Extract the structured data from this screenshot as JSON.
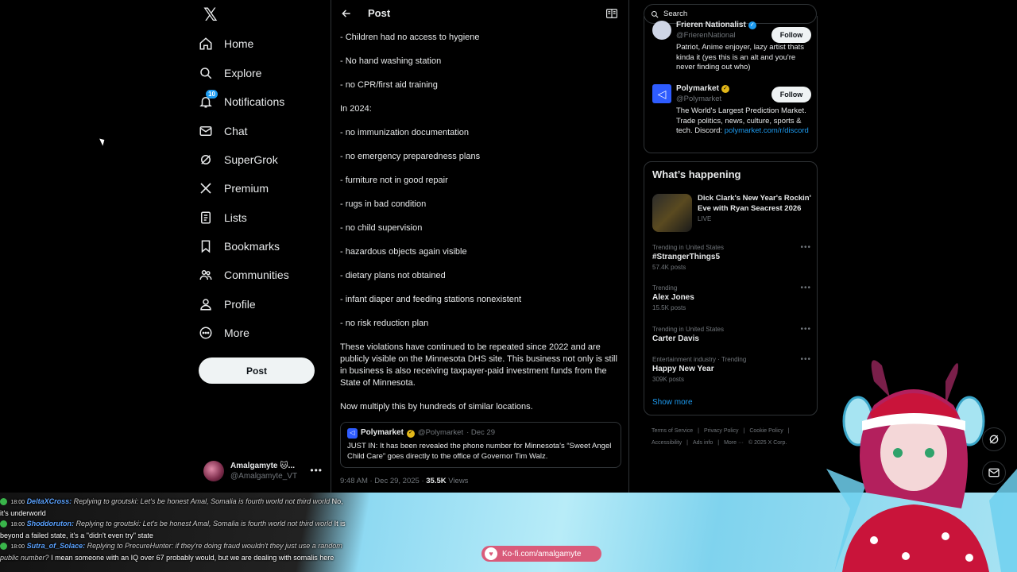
{
  "nav": {
    "logo": "X",
    "items": [
      {
        "label": "Home",
        "icon": "home-icon"
      },
      {
        "label": "Explore",
        "icon": "search-icon"
      },
      {
        "label": "Notifications",
        "icon": "bell-icon",
        "badge": "10"
      },
      {
        "label": "Chat",
        "icon": "mail-icon"
      },
      {
        "label": "SuperGrok",
        "icon": "grok-icon"
      },
      {
        "label": "Premium",
        "icon": "x-icon"
      },
      {
        "label": "Lists",
        "icon": "list-icon"
      },
      {
        "label": "Bookmarks",
        "icon": "bookmark-icon"
      },
      {
        "label": "Communities",
        "icon": "people-icon"
      },
      {
        "label": "Profile",
        "icon": "person-icon"
      },
      {
        "label": "More",
        "icon": "more-circle-icon"
      }
    ],
    "post_button": "Post",
    "account": {
      "name": "Amalgamyte 🐱...",
      "handle": "@Amalgamyte_VT"
    }
  },
  "main": {
    "header_title": "Post",
    "body_lines": [
      "- Children had no access to hygiene",
      "- No hand washing station",
      "- no CPR/first aid training",
      "In 2024:",
      "- no immunization documentation",
      "- no emergency preparedness plans",
      "- furniture not in good repair",
      "- rugs in bad condition",
      "- no child supervision",
      "- hazardous objects again visible",
      "- dietary plans not obtained",
      "- infant diaper and feeding stations nonexistent",
      "- no risk reduction plan",
      "These violations have continued to be repeated since 2022 and are publicly visible on the Minnesota DHS site. This business not only is still in business is also receiving taxpayer-paid investment funds from the State of Minnesota.",
      "Now multiply this by hundreds of similar locations."
    ],
    "quote": {
      "name": "Polymarket",
      "handle": "@Polymarket",
      "date": "· Dec 29",
      "text": "JUST IN: It has been revealed the phone number for Minnesota’s “Sweet Angel Child Care” goes directly to the office of Governor Tim Walz."
    },
    "meta": {
      "time": "9:48 AM · Dec 29, 2025 · ",
      "views_count": "35.5K",
      "views_label": " Views"
    }
  },
  "right": {
    "search_placeholder": "Search",
    "who_to_follow": [
      {
        "name": "Frieren Nationalist",
        "handle": "@FrierenNational",
        "verified": "blue",
        "bio": "Patriot, Anime enjoyer, lazy artist thats kinda it (yes this is an alt and you're never finding out who)",
        "link": "",
        "follow": "Follow",
        "avatar_color": "#cfd6e6"
      },
      {
        "name": "Polymarket",
        "handle": "@Polymarket",
        "verified": "gold",
        "bio": "The World's Largest Prediction Market. Trade politics, news, culture, sports & tech. Discord: ",
        "link": "polymarket.com/r/discord",
        "follow": "Follow",
        "avatar_color": "#2e5cff"
      }
    ],
    "trends_title": "What’s happening",
    "event": {
      "title": "Dick Clark's New Year's Rockin' Eve with Ryan Seacrest 2026",
      "status": "LIVE"
    },
    "trends": [
      {
        "context": "Trending in United States",
        "name": "#StrangerThings5",
        "count": "57.4K posts"
      },
      {
        "context": "Trending",
        "name": "Alex Jones",
        "count": "15.5K posts"
      },
      {
        "context": "Trending in United States",
        "name": "Carter Davis",
        "count": ""
      },
      {
        "context": "Entertainment industry · Trending",
        "name": "Happy New Year",
        "count": "309K posts"
      }
    ],
    "show_more": "Show more",
    "footer": [
      "Terms of Service",
      "|",
      "Privacy Policy",
      "|",
      "Cookie Policy",
      "|",
      "Accessibility",
      "|",
      "Ads info",
      "|",
      "More ···",
      "© 2025 X Corp."
    ]
  },
  "overlay": {
    "chat": [
      {
        "ts": "18:00",
        "user": "DeltaXCross:",
        "reply": "Replying to groutski: Let's be honest Amal, Somalia is fourth world not third world",
        "msg": "No, it's underworld"
      },
      {
        "ts": "18:00",
        "user": "Shoddoruton:",
        "reply": "Replying to groutski: Let's be honest Amal, Somalia is fourth world not third world",
        "msg": "It is beyond a failed state, it's a \"didn't even try\" state"
      },
      {
        "ts": "18:00",
        "user": "Sutra_of_Solace:",
        "reply": "Replying to PrecureHunter: if they're doing fraud wouldn't they just use a random public number?",
        "msg": "I mean someone with an IQ over 67 probably would, but we are dealing with somalis here"
      }
    ],
    "kofi": "Ko-fi.com/amalgamyte"
  }
}
